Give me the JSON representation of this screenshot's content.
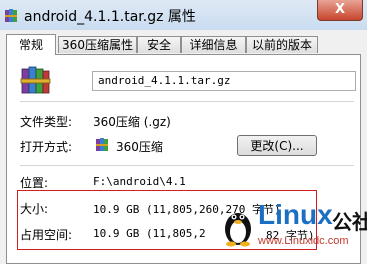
{
  "window": {
    "title": "android_4.1.1.tar.gz 属性",
    "close_label": "X"
  },
  "tabs": [
    {
      "label": "常规",
      "active": true
    },
    {
      "label": "360压缩属性",
      "active": false
    },
    {
      "label": "安全",
      "active": false
    },
    {
      "label": "详细信息",
      "active": false
    },
    {
      "label": "以前的版本",
      "active": false
    }
  ],
  "general": {
    "filename": "android_4.1.1.tar.gz",
    "file_type_label": "文件类型:",
    "file_type_value": "360压缩 (.gz)",
    "open_with_label": "打开方式:",
    "open_with_value": "360压缩",
    "change_button": "更改(C)...",
    "location_label": "位置:",
    "location_value": "F:\\android\\4.1",
    "size_label": "大小:",
    "size_value": "10.9 GB (11,805,260,270 字节)",
    "size_on_disk_label": "占用空间:",
    "size_on_disk_value": "10.9 GB (11,805,2",
    "size_on_disk_tail": "82 字节)"
  },
  "watermark": {
    "brand": "Linux",
    "suffix": "公社",
    "url": "www.Linuxidc.com"
  },
  "colors": {
    "highlight_box": "#d01f1f",
    "watermark_blue": "#1a6fc4"
  }
}
